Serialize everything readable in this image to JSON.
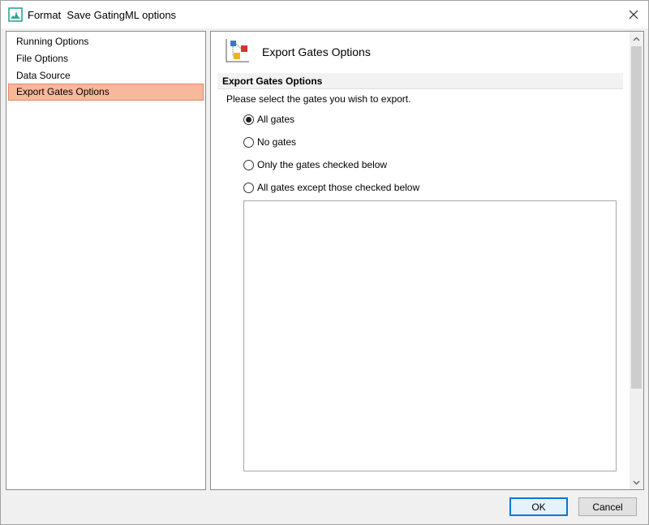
{
  "window": {
    "title": "Format  Save GatingML options"
  },
  "nav": {
    "items": [
      {
        "label": "Running Options",
        "selected": false
      },
      {
        "label": "File Options",
        "selected": false
      },
      {
        "label": "Data Source",
        "selected": false
      },
      {
        "label": "Export Gates Options",
        "selected": true
      }
    ]
  },
  "content": {
    "header_title": "Export Gates Options",
    "section_title": "Export Gates Options",
    "instruction": "Please select the gates you wish to export.",
    "options": [
      {
        "label": "All gates",
        "checked": true
      },
      {
        "label": "No gates",
        "checked": false
      },
      {
        "label": "Only the gates checked below",
        "checked": false
      },
      {
        "label": "All gates except those checked below",
        "checked": false
      }
    ]
  },
  "buttons": {
    "ok_label": "OK",
    "cancel_label": "Cancel"
  },
  "colors": {
    "selected_nav_bg": "#f7b89c",
    "selected_nav_border": "#e8865e",
    "app_icon": "#2aa98b",
    "default_button_border": "#0078d7"
  },
  "icons": {
    "app": "chart-icon",
    "close": "close-icon",
    "header": "gates-export-icon"
  }
}
